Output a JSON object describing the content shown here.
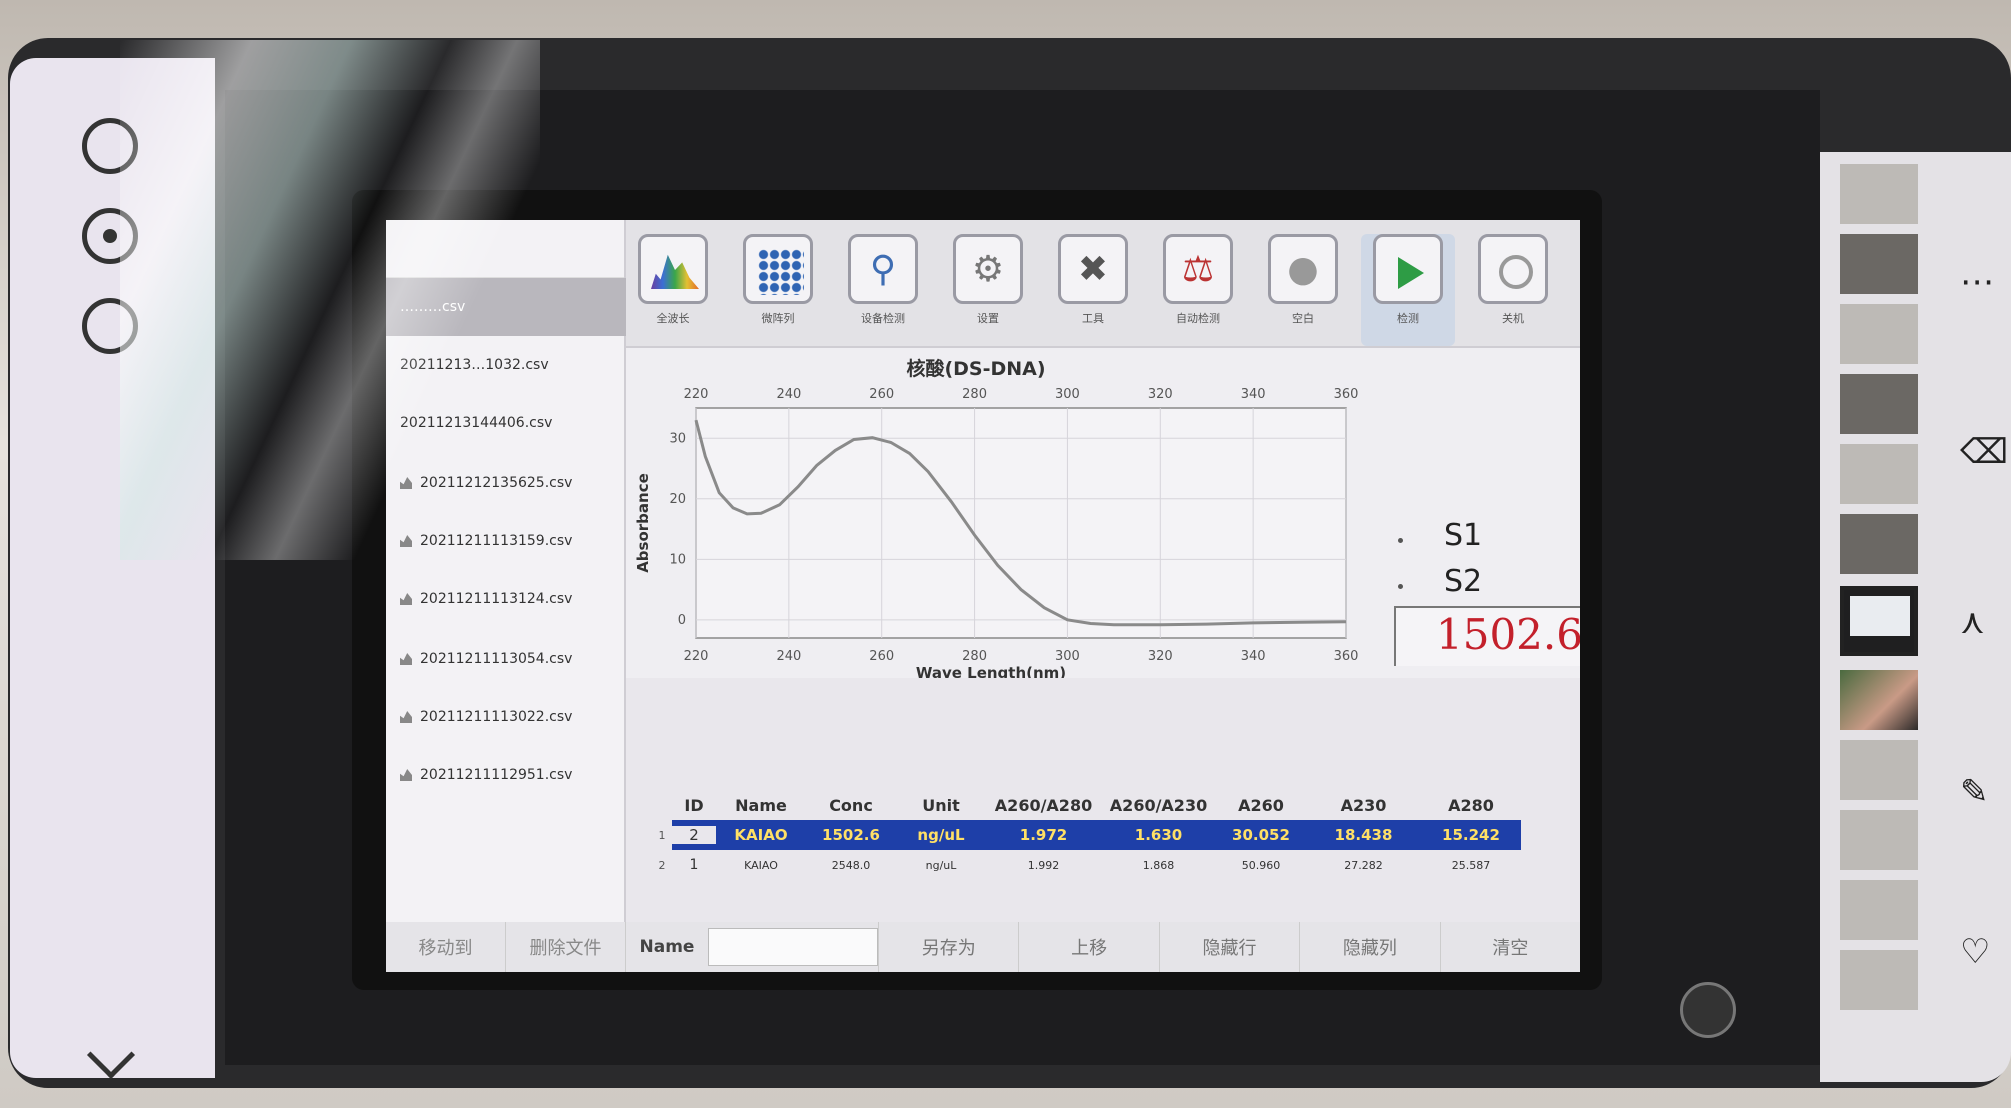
{
  "toolbar": {
    "items": [
      {
        "label": "全波长",
        "icon": "spectrum-icon"
      },
      {
        "label": "微阵列",
        "icon": "grid-icon"
      },
      {
        "label": "设备检测",
        "icon": "search-icon"
      },
      {
        "label": "设置",
        "icon": "gear-icon"
      },
      {
        "label": "工具",
        "icon": "tools-icon"
      },
      {
        "label": "自动检测",
        "icon": "test-tube-icon"
      },
      {
        "label": "空白",
        "icon": "blank-icon"
      },
      {
        "label": "检测",
        "icon": "play-icon"
      },
      {
        "label": "关机",
        "icon": "power-icon"
      }
    ]
  },
  "files": {
    "items": [
      "………csv",
      "20211213…1032.csv",
      "20211213144406.csv",
      "20211212135625.csv",
      "20211211113159.csv",
      "20211211113124.csv",
      "20211211113054.csv",
      "20211211113022.csv",
      "20211211112951.csv"
    ],
    "footer": {
      "move": "移动到",
      "delete": "删除文件"
    }
  },
  "chart_data": {
    "type": "line",
    "title": "核酸(DS-DNA)",
    "xlabel": "Wave Length(nm)",
    "ylabel": "Absorbance",
    "xlim": [
      220,
      360
    ],
    "ylim": [
      -3,
      35
    ],
    "x_ticks": [
      220,
      240,
      260,
      280,
      300,
      320,
      340,
      360
    ],
    "y_ticks": [
      0,
      10,
      20,
      30
    ],
    "grid": true,
    "series": [
      {
        "x": [
          220,
          222,
          225,
          228,
          231,
          234,
          238,
          242,
          246,
          250,
          254,
          258,
          262,
          266,
          270,
          275,
          280,
          285,
          290,
          295,
          300,
          305,
          310,
          320,
          330,
          340,
          350,
          360
        ],
        "y": [
          33,
          27,
          21,
          18.5,
          17.5,
          17.6,
          19,
          22,
          25.5,
          28,
          29.8,
          30.1,
          29.3,
          27.5,
          24.5,
          19.5,
          14,
          9,
          5,
          2,
          0,
          -0.6,
          -0.8,
          -0.8,
          -0.7,
          -0.5,
          -0.4,
          -0.3
        ]
      }
    ]
  },
  "readout": {
    "s1": "S1",
    "s2": "S2",
    "value": "1502.6",
    "value_color": "#c3202b"
  },
  "table": {
    "headers": [
      "ID",
      "Name",
      "Conc",
      "Unit",
      "A260/A280",
      "A260/A230",
      "A260",
      "A230",
      "A280"
    ],
    "rows": [
      {
        "row": "1",
        "id": "2",
        "name": "KAIAO",
        "conc": "1502.6",
        "unit": "ng/uL",
        "r1": "1.972",
        "r2": "1.630",
        "a260": "30.052",
        "a230": "18.438",
        "a280": "15.242",
        "selected": true
      },
      {
        "row": "2",
        "id": "1",
        "name": "KAIAO",
        "conc": "2548.0",
        "unit": "ng/uL",
        "r1": "1.992",
        "r2": "1.868",
        "a260": "50.960",
        "a230": "27.282",
        "a280": "25.587",
        "selected": false
      }
    ],
    "selection_color": "#1e3fa8"
  },
  "bottombar": {
    "name_label": "Name",
    "name_value": "",
    "save_as": "另存为",
    "move_up": "上移",
    "hide_row": "隐藏行",
    "hide_col": "隐藏列",
    "clear": "清空"
  }
}
